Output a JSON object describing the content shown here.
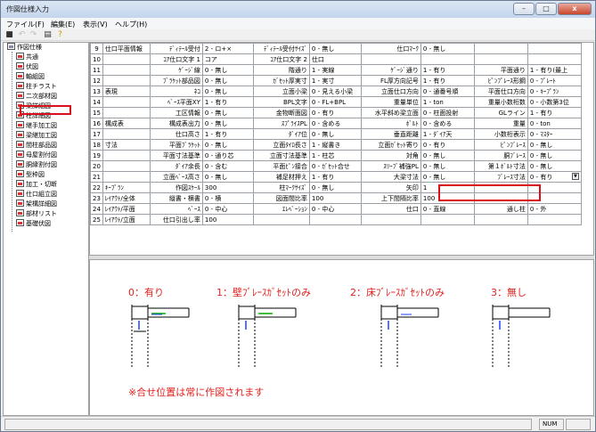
{
  "window": {
    "title": "作図仕様入力",
    "min": "–",
    "max": "□",
    "close": "x"
  },
  "menu": [
    "ファイル(F)",
    "編集(E)",
    "表示(V)",
    "ヘルプ(H)"
  ],
  "tree": {
    "root": "作図仕様",
    "items": [
      "共通",
      "伏図",
      "軸組図",
      "柱チラスト",
      "二次部材図",
      "梁詳細図",
      "柱詳細図",
      "継手加工図",
      "梁継加工図",
      "間柱部品図",
      "母屋割付図",
      "胴縁割付図",
      "型枠図",
      "加工・切断",
      "仕口組立図",
      "架構詳細図",
      "部材リスト",
      "基礎伏図"
    ],
    "selected_index": 6
  },
  "grid": {
    "rows": [
      {
        "num": "9",
        "cells": [
          [
            "cat",
            "仕口平面情報"
          ],
          [
            "lbl",
            "ﾃﾞｨﾃｰﾙ受付"
          ],
          [
            "val",
            "2 - ロ+×"
          ],
          [
            "lbl",
            "ﾃﾞｨﾃｰﾙ受付ｻｲｽﾞ"
          ],
          [
            "val",
            "0 - 無し"
          ],
          [
            "lbl",
            "仕口ﾏｰｸ"
          ],
          [
            "val",
            "0 - 無し"
          ],
          [
            "g",
            ""
          ],
          [
            "g",
            ""
          ]
        ]
      },
      {
        "num": "10",
        "cells": [
          [
            "cat",
            ""
          ],
          [
            "lbl",
            "ｺｱ仕口文字 1"
          ],
          [
            "val",
            "コア"
          ],
          [
            "lbl",
            "ｺｱ仕口文字 2"
          ],
          [
            "val",
            "仕口"
          ],
          [
            "g",
            ""
          ],
          [
            "g",
            ""
          ],
          [
            "g",
            ""
          ],
          [
            "g",
            ""
          ]
        ]
      },
      {
        "num": "11",
        "cells": [
          [
            "cat",
            ""
          ],
          [
            "lbl",
            "ｹﾞｰｼﾞ線"
          ],
          [
            "val",
            "0 - 無し"
          ],
          [
            "lbl",
            "階通り"
          ],
          [
            "val",
            "1 - 実線"
          ],
          [
            "lbl",
            "ｹﾞｰｼﾞ通り"
          ],
          [
            "val",
            "1 - 有り"
          ],
          [
            "lbl",
            "平面通り"
          ],
          [
            "val",
            "1 - 有り(最上"
          ]
        ]
      },
      {
        "num": "12",
        "cells": [
          [
            "cat",
            ""
          ],
          [
            "lbl",
            "ﾌﾞﾗｹｯﾄ部品図"
          ],
          [
            "val",
            "0 - 無し"
          ],
          [
            "lbl",
            "ｶﾞｾｯﾄ厚実寸"
          ],
          [
            "val",
            "1 - 実寸"
          ],
          [
            "lbl",
            "FL厚方向記号"
          ],
          [
            "val",
            "1 - 有り"
          ],
          [
            "lbl",
            "ﾋﾟﾝﾌﾟﾚｰｽ形鋼"
          ],
          [
            "val",
            "0 - ﾌﾟﾚｰﾄ"
          ]
        ]
      },
      {
        "num": "13",
        "cells": [
          [
            "cat",
            "表現"
          ],
          [
            "lbl",
            "ﾈｺ"
          ],
          [
            "val",
            "0 - 無し"
          ],
          [
            "lbl",
            "立面小梁"
          ],
          [
            "val",
            "0 - 見える小梁"
          ],
          [
            "lbl",
            "立面仕口方向"
          ],
          [
            "val",
            "0 - 通番号順"
          ],
          [
            "lbl",
            "平面仕口方向"
          ],
          [
            "val",
            "0 - ｷｰﾌﾟﾗﾝ"
          ]
        ]
      },
      {
        "num": "14",
        "cells": [
          [
            "cat",
            ""
          ],
          [
            "lbl",
            "ﾍﾞｰｽ平面XY"
          ],
          [
            "val",
            "1 - 有り"
          ],
          [
            "lbl",
            "BPL文字"
          ],
          [
            "val",
            "0 - FL+BPL"
          ],
          [
            "lbl",
            "重量単位"
          ],
          [
            "val",
            "1 - ton"
          ],
          [
            "lbl",
            "重量小数桁数"
          ],
          [
            "val",
            "0 - 小数第3位"
          ]
        ]
      },
      {
        "num": "15",
        "cells": [
          [
            "cat",
            ""
          ],
          [
            "lbl",
            "工区情報"
          ],
          [
            "val",
            "0 - 無し"
          ],
          [
            "lbl",
            "金物断面図"
          ],
          [
            "val",
            "0 - 有り"
          ],
          [
            "lbl",
            "水平斜め梁立面"
          ],
          [
            "val",
            "0 - 柱面投射"
          ],
          [
            "lbl",
            "GLライン"
          ],
          [
            "val",
            "1 - 有り"
          ]
        ]
      },
      {
        "num": "16",
        "cells": [
          [
            "cat",
            "構成表"
          ],
          [
            "lbl",
            "構成表出力"
          ],
          [
            "val",
            "0 - 無し"
          ],
          [
            "lbl",
            "ｽﾌﾟﾗｲｽPL"
          ],
          [
            "val",
            "0 - 含める"
          ],
          [
            "lbl",
            "ﾎﾞﾙﾄ"
          ],
          [
            "val",
            "0 - 含める"
          ],
          [
            "lbl",
            "重量"
          ],
          [
            "val",
            "0 - ton"
          ]
        ]
      },
      {
        "num": "17",
        "cells": [
          [
            "cat",
            ""
          ],
          [
            "lbl",
            "仕口高さ"
          ],
          [
            "val",
            "1 - 有り"
          ],
          [
            "lbl",
            "ﾀﾞｲｱ位"
          ],
          [
            "val",
            "0 - 無し"
          ],
          [
            "lbl",
            "垂直距離"
          ],
          [
            "val",
            "1 - ﾀﾞｲｱ天"
          ],
          [
            "lbl",
            "小数桁表示"
          ],
          [
            "val",
            "0 - ﾏｽﾀｰ"
          ]
        ]
      },
      {
        "num": "18",
        "cells": [
          [
            "cat",
            "寸法"
          ],
          [
            "lbl",
            "平面ﾌﾞﾗｹｯﾄ"
          ],
          [
            "val",
            "0 - 無し"
          ],
          [
            "lbl",
            "立面ﾀｲﾛ長さ"
          ],
          [
            "val",
            "1 - 縦書き"
          ],
          [
            "lbl",
            "立面ｶﾞｾｯﾄ寄り"
          ],
          [
            "val",
            "0 - 有り"
          ],
          [
            "lbl",
            "ﾋﾟﾝﾌﾞﾚｰｽ"
          ],
          [
            "val",
            "0 - 無し"
          ]
        ]
      },
      {
        "num": "19",
        "cells": [
          [
            "cat",
            ""
          ],
          [
            "lbl",
            "平面寸法基準"
          ],
          [
            "val",
            "0 - 通り芯"
          ],
          [
            "lbl",
            "立面寸法基準"
          ],
          [
            "val",
            "1 - 柱芯"
          ],
          [
            "lbl",
            "対角"
          ],
          [
            "val",
            "0 - 無し"
          ],
          [
            "lbl",
            "胴ﾌﾞﾚｰｽ"
          ],
          [
            "val",
            "0 - 無し"
          ]
        ]
      },
      {
        "num": "20",
        "cells": [
          [
            "cat",
            ""
          ],
          [
            "lbl",
            "ﾀﾞｲｱ余長"
          ],
          [
            "val",
            "0 - 含む"
          ],
          [
            "lbl",
            "平面ﾋﾟﾝ接合"
          ],
          [
            "val",
            "0 - ｶﾞｾｯﾄ合せ"
          ],
          [
            "lbl",
            "ｽﾘｰﾌﾞ補強PL"
          ],
          [
            "val",
            "0 - 無し"
          ],
          [
            "lbl",
            "第１ﾎﾞﾙﾄ寸法"
          ],
          [
            "val",
            "0 - 無し"
          ]
        ]
      },
      {
        "num": "21",
        "cells": [
          [
            "cat",
            ""
          ],
          [
            "lbl",
            "立面ﾍﾞｰｽ高さ"
          ],
          [
            "val",
            "0 - 無し"
          ],
          [
            "lbl",
            "補足材押え"
          ],
          [
            "val",
            "1 - 有り"
          ],
          [
            "lbl",
            "大梁寸法"
          ],
          [
            "val",
            "0 - 無し"
          ],
          [
            "lbl",
            "ﾌﾞﾚｰｽ寸法"
          ],
          [
            "val",
            "0 - 有り"
          ]
        ]
      },
      {
        "num": "22",
        "cells": [
          [
            "cat",
            "ｷｰﾌﾟﾗﾝ"
          ],
          [
            "lbl",
            "作図ｽｹｰﾙ"
          ],
          [
            "val",
            "300"
          ],
          [
            "lbl",
            "柱ﾏｰｸｻｲｽﾞ"
          ],
          [
            "val",
            "0 - 無し"
          ],
          [
            "lbl",
            "矢印"
          ],
          [
            "val",
            "1"
          ],
          [
            "g",
            ""
          ],
          [
            "g",
            ""
          ]
        ]
      },
      {
        "num": "23",
        "cells": [
          [
            "cat",
            "ﾚｲｱｳﾄ/全体"
          ],
          [
            "lbl",
            "縦書・横書"
          ],
          [
            "val",
            "0 - 横"
          ],
          [
            "lbl",
            "図面間比率"
          ],
          [
            "val",
            "100"
          ],
          [
            "lbl",
            "上下間隔比率"
          ],
          [
            "val",
            "100"
          ],
          [
            "g",
            ""
          ],
          [
            "g",
            ""
          ]
        ]
      },
      {
        "num": "24",
        "cells": [
          [
            "cat",
            "ﾚｲｱｳﾄ/平面"
          ],
          [
            "lbl",
            "ﾍﾞｰｽ"
          ],
          [
            "val",
            "0 - 中心"
          ],
          [
            "lbl",
            "ｴﾚﾍﾞｰｼｮﾝ"
          ],
          [
            "val",
            "0 - 中心"
          ],
          [
            "lbl",
            "仕口"
          ],
          [
            "val",
            "0 - 直線"
          ],
          [
            "lbl",
            "通し柱"
          ],
          [
            "val",
            "0 - 外"
          ]
        ]
      },
      {
        "num": "25",
        "cells": [
          [
            "cat",
            "ﾚｲｱｳﾄ/立面"
          ],
          [
            "lbl",
            "仕口引出し率"
          ],
          [
            "val",
            "100"
          ],
          [
            "g",
            ""
          ],
          [
            "g",
            ""
          ],
          [
            "g",
            ""
          ],
          [
            "g",
            ""
          ],
          [
            "g",
            ""
          ],
          [
            "g",
            ""
          ]
        ]
      }
    ]
  },
  "preview": {
    "options": [
      "0：有り",
      "1：壁ﾌﾞﾚｰｽｶﾞｾｯﾄのみ",
      "2：床ﾌﾞﾚｰｽｶﾞｾｯﾄのみ",
      "3：無し"
    ],
    "note": "※合せ位置は常に作図されます"
  },
  "status": {
    "num": "NUM"
  }
}
